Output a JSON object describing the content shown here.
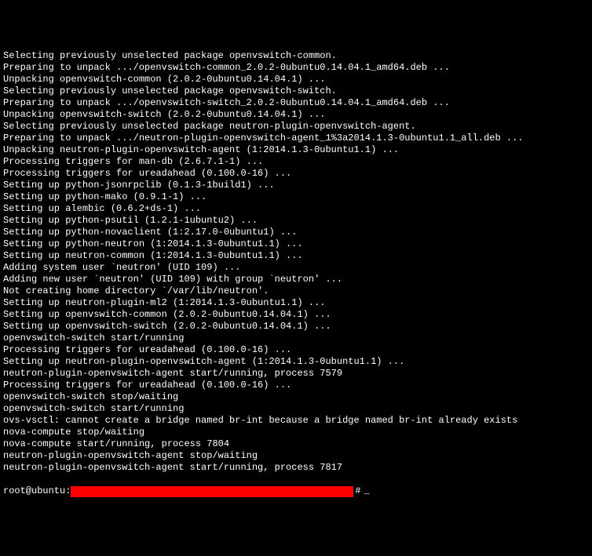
{
  "lines": [
    "Selecting previously unselected package openvswitch-common.",
    "Preparing to unpack .../openvswitch-common_2.0.2-0ubuntu0.14.04.1_amd64.deb ...",
    "Unpacking openvswitch-common (2.0.2-0ubuntu0.14.04.1) ...",
    "Selecting previously unselected package openvswitch-switch.",
    "Preparing to unpack .../openvswitch-switch_2.0.2-0ubuntu0.14.04.1_amd64.deb ...",
    "Unpacking openvswitch-switch (2.0.2-0ubuntu0.14.04.1) ...",
    "Selecting previously unselected package neutron-plugin-openvswitch-agent.",
    "Preparing to unpack .../neutron-plugin-openvswitch-agent_1%3a2014.1.3-0ubuntu1.1_all.deb ...",
    "Unpacking neutron-plugin-openvswitch-agent (1:2014.1.3-0ubuntu1.1) ...",
    "Processing triggers for man-db (2.6.7.1-1) ...",
    "Processing triggers for ureadahead (0.100.0-16) ...",
    "Setting up python-jsonrpclib (0.1.3-1build1) ...",
    "Setting up python-mako (0.9.1-1) ...",
    "Setting up alembic (0.6.2+ds-1) ...",
    "Setting up python-psutil (1.2.1-1ubuntu2) ...",
    "Setting up python-novaclient (1:2.17.0-0ubuntu1) ...",
    "Setting up python-neutron (1:2014.1.3-0ubuntu1.1) ...",
    "Setting up neutron-common (1:2014.1.3-0ubuntu1.1) ...",
    "Adding system user `neutron' (UID 109) ...",
    "Adding new user `neutron' (UID 109) with group `neutron' ...",
    "Not creating home directory `/var/lib/neutron'.",
    "Setting up neutron-plugin-ml2 (1:2014.1.3-0ubuntu1.1) ...",
    "Setting up openvswitch-common (2.0.2-0ubuntu0.14.04.1) ...",
    "Setting up openvswitch-switch (2.0.2-0ubuntu0.14.04.1) ...",
    "openvswitch-switch start/running",
    "Processing triggers for ureadahead (0.100.0-16) ...",
    "Setting up neutron-plugin-openvswitch-agent (1:2014.1.3-0ubuntu1.1) ...",
    "neutron-plugin-openvswitch-agent start/running, process 7579",
    "Processing triggers for ureadahead (0.100.0-16) ...",
    "openvswitch-switch stop/waiting",
    "openvswitch-switch start/running",
    "ovs-vsctl: cannot create a bridge named br-int because a bridge named br-int already exists",
    "nova-compute stop/waiting",
    "nova-compute start/running, process 7804",
    "neutron-plugin-openvswitch-agent stop/waiting",
    "neutron-plugin-openvswitch-agent start/running, process 7817"
  ],
  "prompt": {
    "user_host": "root@ubuntu:",
    "hash": "#",
    "cursor": "_"
  }
}
